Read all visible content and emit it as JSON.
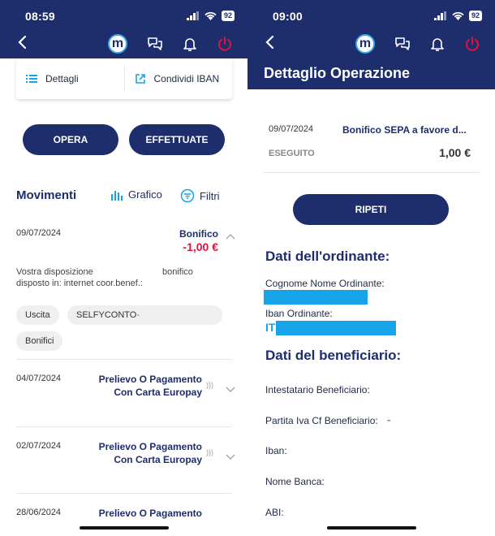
{
  "left_screen": {
    "status": {
      "time": "08:59",
      "battery": "92"
    },
    "card": {
      "details_label": "Dettagli",
      "share_iban_label": "Condividi IBAN"
    },
    "actions": {
      "opera_label": "OPERA",
      "effettuate_label": "EFFETTUATE"
    },
    "movements": {
      "title": "Movimenti",
      "chart_label": "Grafico",
      "filter_label": "Filtri"
    },
    "rows": [
      {
        "date": "09/07/2024",
        "title": "Bonifico",
        "amount": "-1,00 €",
        "desc_part1": "Vostra disposizione",
        "desc_part2": "bonifico",
        "desc_line2": "disposto in: internet coor.benef.:",
        "tags": [
          "Uscita",
          "SELFYCONTO·",
          "Bonifici"
        ]
      },
      {
        "date": "04/07/2024",
        "title_line1": "Prelievo O Pagamento",
        "title_line2": "Con Carta Europay"
      },
      {
        "date": "02/07/2024",
        "title_line1": "Prelievo O Pagamento",
        "title_line2": "Con Carta Europay"
      },
      {
        "date": "28/06/2024",
        "title_line1": "Prelievo O Pagamento"
      }
    ]
  },
  "right_screen": {
    "status": {
      "time": "09:00",
      "battery": "92"
    },
    "title": "Dettaglio Operazione",
    "operation": {
      "date": "09/07/2024",
      "label": "Bonifico SEPA a favore d...",
      "state": "ESEGUITO",
      "amount": "1,00 €"
    },
    "repeat_label": "RIPETI",
    "ordering_section": "Dati dell'ordinante:",
    "ordering_name_label": "Cognome Nome Ordinante:",
    "ordering_iban_label": "Iban Ordinante:",
    "ordering_iban_prefix": "IT",
    "beneficiary_section": "Dati del beneficiario:",
    "beneficiary_holder_label": "Intestatario Beneficiario:",
    "beneficiary_vat_label": "Partita Iva Cf Beneficiario:",
    "beneficiary_vat_value": "-",
    "iban_label": "Iban:",
    "bank_name_label": "Nome Banca:",
    "abi_label": "ABI:"
  },
  "colors": {
    "navy": "#1e2d6b",
    "accent_blue": "#16a3e8",
    "negative": "#e0133c",
    "power_icon": "#e0133c"
  },
  "icons": [
    "back-arrow-icon",
    "m-logo-icon",
    "chat-icon",
    "bell-icon",
    "power-icon",
    "list-icon",
    "share-icon",
    "bar-chart-icon",
    "filter-icon",
    "chevron-icon",
    "nfc-icon",
    "signal-icon",
    "wifi-icon",
    "battery-icon"
  ]
}
